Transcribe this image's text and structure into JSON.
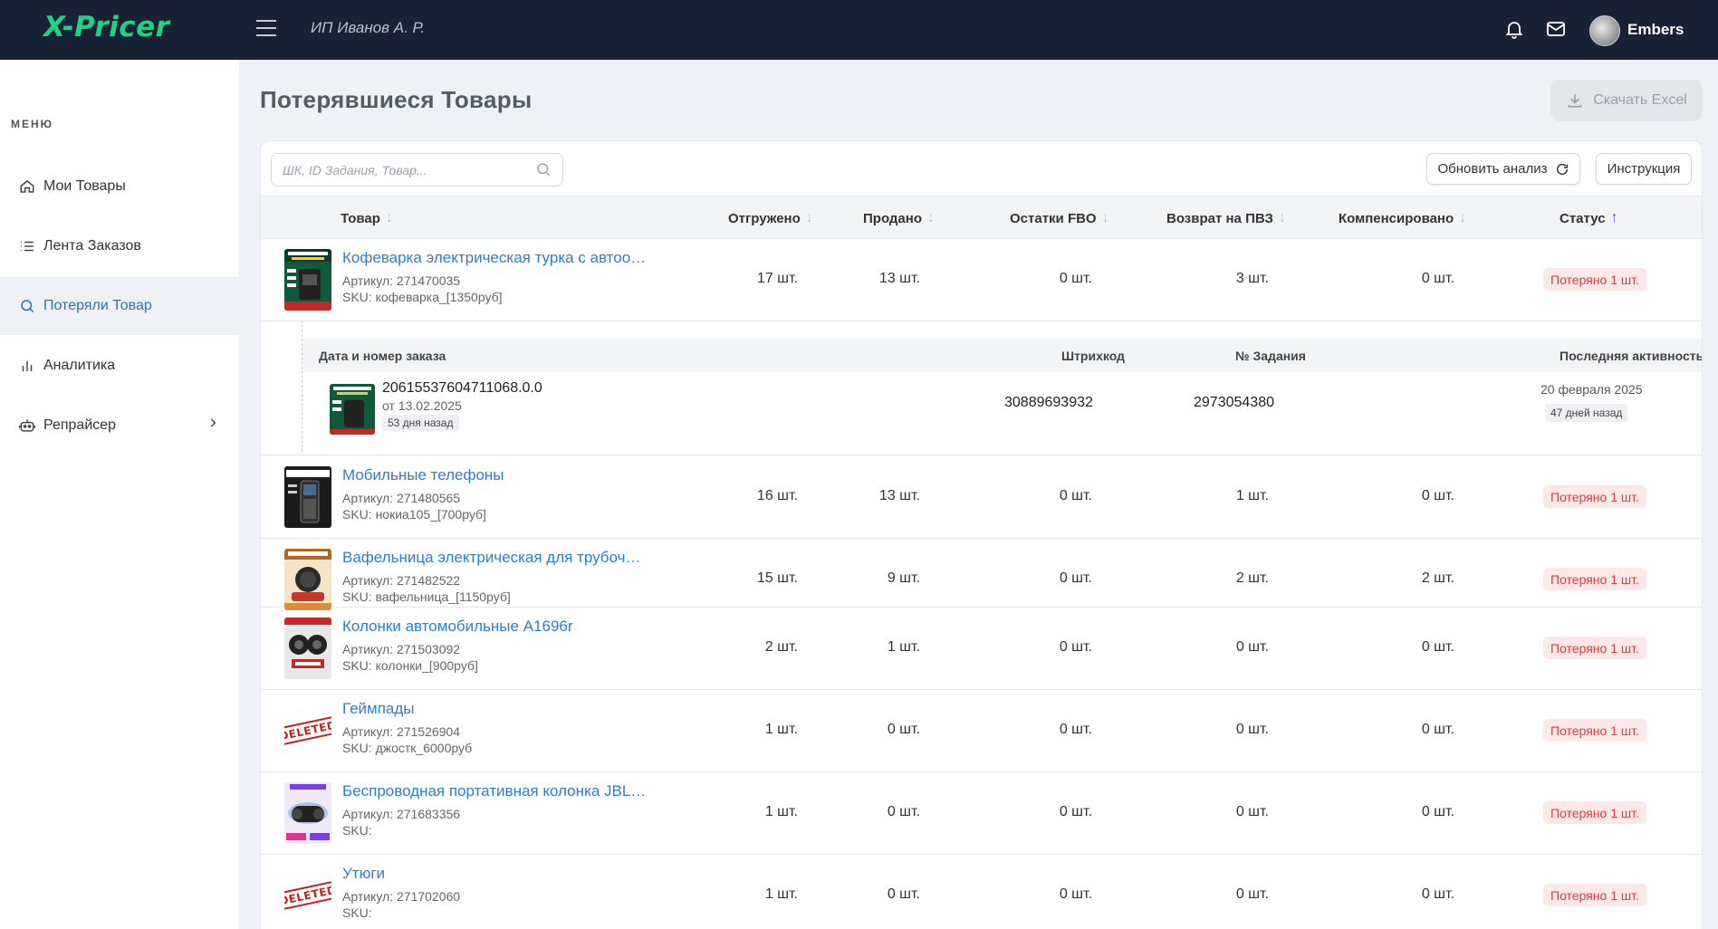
{
  "app": {
    "logo": "X-Pricer",
    "company": "ИП Иванов А. Р.",
    "username": "Embers"
  },
  "sidebar": {
    "menu_label": "МЕНЮ",
    "items": [
      {
        "label": "Мои Товары",
        "icon": "home-icon"
      },
      {
        "label": "Лента Заказов",
        "icon": "list-icon"
      },
      {
        "label": "Потеряли Товар",
        "icon": "search-icon"
      },
      {
        "label": "Аналитика",
        "icon": "chart-icon"
      },
      {
        "label": "Репрайсер",
        "icon": "robot-icon"
      }
    ]
  },
  "page": {
    "title": "Потерявшиеся Товары",
    "excel_label": "Скачать Excel",
    "search_placeholder": "ШК, ID Задания, Товар...",
    "refresh_label": "Обновить анализ",
    "help_label": "Инструкция"
  },
  "table": {
    "headers": {
      "product": "Товар",
      "shipped": "Отгружено",
      "sold": "Продано",
      "fbo": "Остатки FBO",
      "returns": "Возврат на ПВЗ",
      "compensated": "Компенсировано",
      "status": "Статус"
    },
    "rows": [
      {
        "name": "Кофеварка электрическая турка с автоо…",
        "article": "Артикул: 271470035",
        "sku": "SKU: кофеварка_[1350руб]",
        "shipped": "17 шт.",
        "sold": "13 шт.",
        "fbo": "0 шт.",
        "returns": "3 шт.",
        "compensated": "0 шт.",
        "status": "Потеряно 1 шт."
      },
      {
        "name": "Мобильные телефоны",
        "article": "Артикул: 271480565",
        "sku": "SKU: нокиа105_[700руб]",
        "shipped": "16 шт.",
        "sold": "13 шт.",
        "fbo": "0 шт.",
        "returns": "1 шт.",
        "compensated": "0 шт.",
        "status": "Потеряно 1 шт."
      },
      {
        "name": "Вафельница электрическая для трубоч…",
        "article": "Артикул: 271482522",
        "sku": "SKU: вафельница_[1150руб]",
        "shipped": "15 шт.",
        "sold": "9 шт.",
        "fbo": "0 шт.",
        "returns": "2 шт.",
        "compensated": "2 шт.",
        "status": "Потеряно 1 шт."
      },
      {
        "name": "Колонки автомобильные A1696r",
        "article": "Артикул: 271503092",
        "sku": "SKU: колонки_[900руб]",
        "shipped": "2 шт.",
        "sold": "1 шт.",
        "fbo": "0 шт.",
        "returns": "0 шт.",
        "compensated": "0 шт.",
        "status": "Потеряно 1 шт."
      },
      {
        "name": "Геймпады",
        "article": "Артикул: 271526904",
        "sku": "SKU: джостк_6000руб",
        "shipped": "1 шт.",
        "sold": "0 шт.",
        "fbo": "0 шт.",
        "returns": "0 шт.",
        "compensated": "0 шт.",
        "status": "Потеряно 1 шт."
      },
      {
        "name": "Беспроводная портативная колонка JBL…",
        "article": "Артикул: 271683356",
        "sku": "SKU:",
        "shipped": "1 шт.",
        "sold": "0 шт.",
        "fbo": "0 шт.",
        "returns": "0 шт.",
        "compensated": "0 шт.",
        "status": "Потеряно 1 шт."
      },
      {
        "name": "Утюги",
        "article": "Артикул: 271702060",
        "sku": "SKU:",
        "shipped": "1 шт.",
        "sold": "0 шт.",
        "fbo": "0 шт.",
        "returns": "0 шт.",
        "compensated": "0 шт.",
        "status": "Потеряно 1 шт."
      }
    ]
  },
  "detail": {
    "headers": {
      "order": "Дата и номер заказа",
      "barcode": "Штрихкод",
      "task": "№ Задания",
      "last_activity": "Последняя активность"
    },
    "order_no": "20615537604711068.0.0",
    "order_date": "от 13.02.2025",
    "order_ago": "53 дня назад",
    "barcode": "30889693932",
    "task": "2973054380",
    "last_date": "20 февраля 2025",
    "last_ago": "47 дней назад"
  },
  "thumbs": {
    "deleted_text": "DELETED"
  },
  "colors": {
    "topbar": "#172234",
    "logo": "#1fd384",
    "link": "#2b7fd1",
    "status_bg": "#fde8e8",
    "status_text": "#e23b3b",
    "sort_active": "#7b3fe4"
  }
}
